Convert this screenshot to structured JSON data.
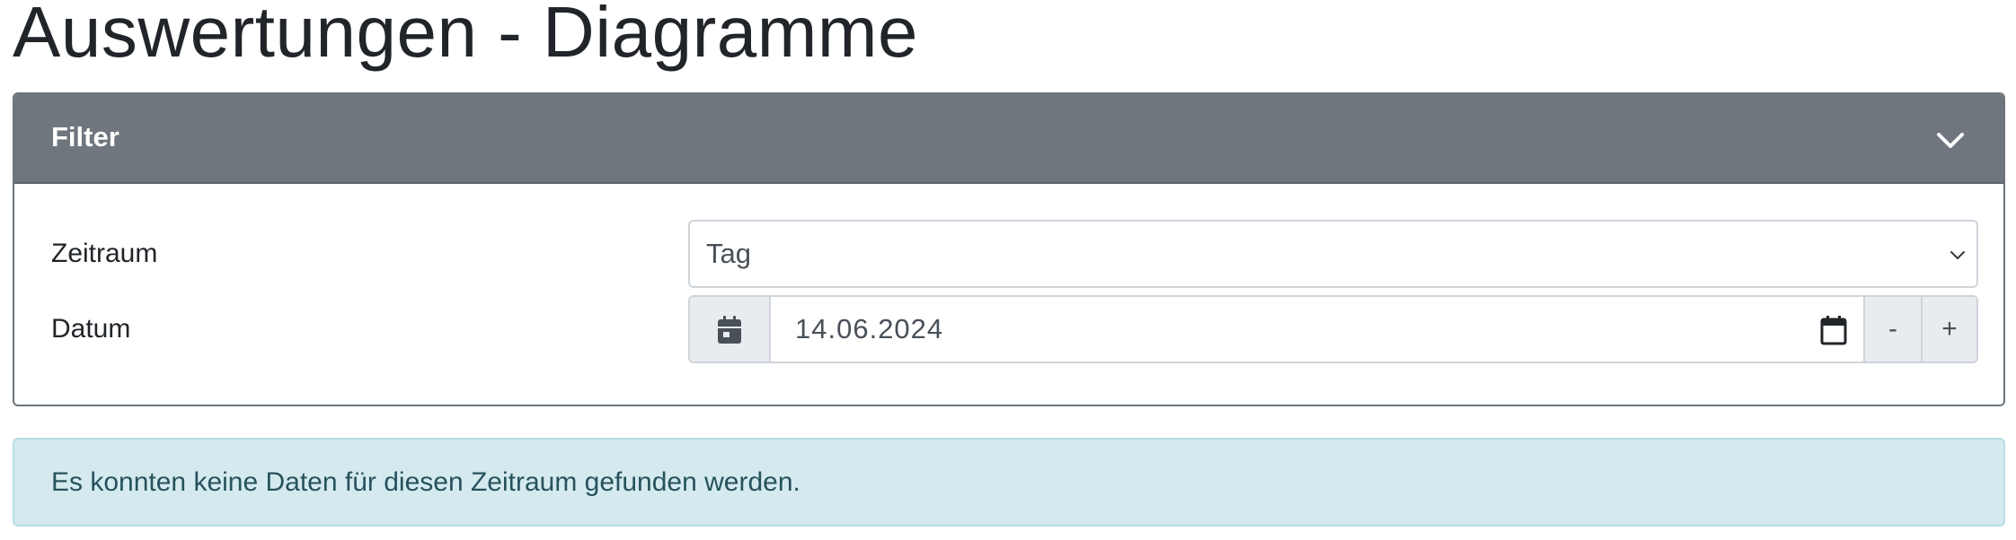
{
  "page": {
    "title": "Auswertungen - Diagramme"
  },
  "filter": {
    "header_title": "Filter",
    "toggle_icon": "chevron-down-icon",
    "fields": {
      "zeitraum": {
        "label": "Zeitraum",
        "selected_value": "Tag"
      },
      "datum": {
        "label": "Datum",
        "value": "14.06.2024",
        "prepend_icon": "calendar-icon",
        "decrement_label": "-",
        "increment_label": "+"
      }
    }
  },
  "alert": {
    "message": "Es konnten keine Daten für diesen Zeitraum gefunden werden."
  },
  "colors": {
    "card_header": "#6f767e",
    "alert_background": "#d4eaef",
    "alert_text": "#27525c"
  }
}
